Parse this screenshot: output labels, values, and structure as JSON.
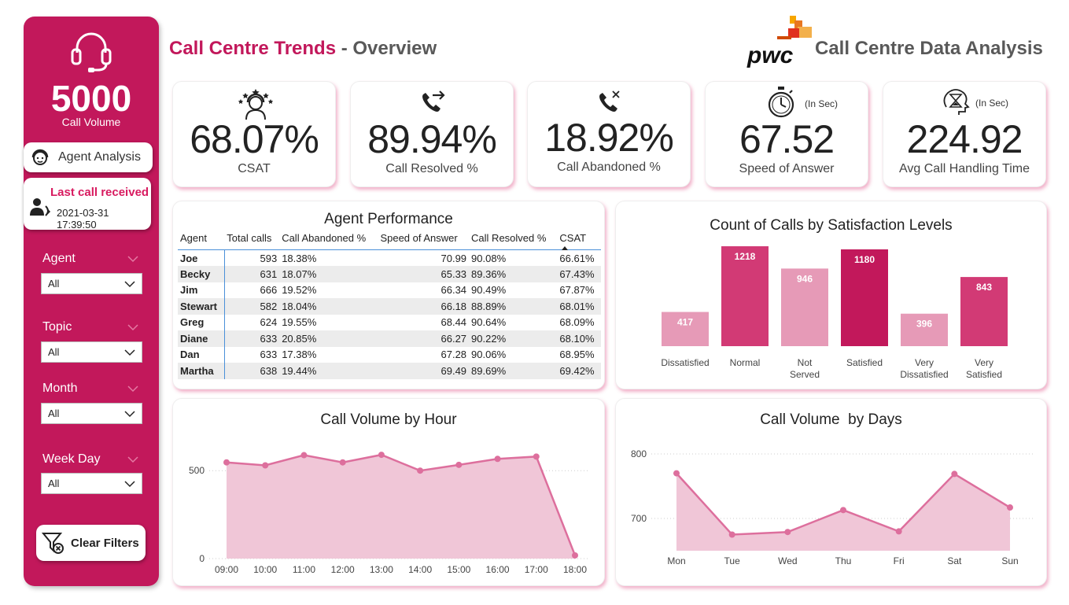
{
  "sidebar": {
    "call_volume": "5000",
    "call_volume_label": "Call Volume",
    "agent_analysis_label": "Agent Analysis",
    "last_call_label": "Last call received",
    "last_call_time": "2021-03-31 17:39:50",
    "filters": [
      {
        "label": "Agent",
        "value": "All"
      },
      {
        "label": "Topic",
        "value": "All"
      },
      {
        "label": "Month",
        "value": "All"
      },
      {
        "label": "Week Day",
        "value": "All"
      }
    ],
    "clear_filters_label": "Clear Filters"
  },
  "header": {
    "title_part1": "Call Centre Trends",
    "title_sep": " - ",
    "title_part2": "Overview",
    "brand_logo_text": "pwc",
    "brand_title": "Call Centre Data Analysis"
  },
  "kpis": [
    {
      "value": "68.07%",
      "label": "CSAT",
      "icon": "agent-rating-icon"
    },
    {
      "value": "89.94%",
      "label": "Call Resolved %",
      "icon": "phone-forward-icon"
    },
    {
      "value": "18.92%",
      "label": "Call Abandoned %",
      "icon": "phone-cancel-icon"
    },
    {
      "value": "67.52",
      "label": "Speed of Answer",
      "unit": "(In Sec)",
      "icon": "stopwatch-icon"
    },
    {
      "value": "224.92",
      "label": "Avg Call Handling Time",
      "unit": "(In Sec)",
      "icon": "hourglass-head-icon"
    }
  ],
  "agent_table": {
    "title": "Agent Performance",
    "columns": [
      "Agent",
      "Total calls",
      "Call Abandoned %",
      "Speed of Answer",
      "Call Resolved %",
      "CSAT"
    ],
    "rows": [
      [
        "Joe",
        "593",
        "18.38%",
        "70.99",
        "90.08%",
        "66.61%"
      ],
      [
        "Becky",
        "631",
        "18.07%",
        "65.33",
        "89.36%",
        "67.43%"
      ],
      [
        "Jim",
        "666",
        "19.52%",
        "66.34",
        "90.49%",
        "67.87%"
      ],
      [
        "Stewart",
        "582",
        "18.04%",
        "66.18",
        "88.89%",
        "68.01%"
      ],
      [
        "Greg",
        "624",
        "19.55%",
        "68.44",
        "90.64%",
        "68.09%"
      ],
      [
        "Diane",
        "633",
        "20.85%",
        "66.27",
        "90.22%",
        "68.10%"
      ],
      [
        "Dan",
        "633",
        "17.38%",
        "67.28",
        "90.06%",
        "68.95%"
      ],
      [
        "Martha",
        "638",
        "19.44%",
        "69.49",
        "89.69%",
        "69.42%"
      ]
    ]
  },
  "colors": {
    "primary": "#c2185b",
    "bar_dark": "#c2185b",
    "bar_mid": "#d23a75",
    "bar_light": "#e69ab7",
    "area_line": "#dd6f9d",
    "area_fill": "#f0c6d7"
  },
  "chart_data": [
    {
      "type": "bar",
      "title": "Count of Calls by Satisfaction Levels",
      "categories": [
        "Dissatisfied",
        "Normal",
        "Not Served",
        "Satisfied",
        "Very Dissatisfied",
        "Very Satisfied"
      ],
      "values": [
        417,
        1218,
        946,
        1180,
        396,
        843
      ],
      "shade": [
        "light",
        "mid",
        "light",
        "dark",
        "light",
        "mid"
      ]
    },
    {
      "type": "area",
      "title": "Call Volume by Hour",
      "categories": [
        "09:00",
        "10:00",
        "11:00",
        "12:00",
        "13:00",
        "14:00",
        "15:00",
        "16:00",
        "17:00",
        "18:00"
      ],
      "values": [
        547,
        530,
        588,
        547,
        590,
        500,
        533,
        567,
        580,
        18
      ],
      "yticks": [
        0,
        500
      ],
      "ylim": [
        0,
        700
      ]
    },
    {
      "type": "area",
      "title": "Call Volume  by Days",
      "categories": [
        "Mon",
        "Tue",
        "Wed",
        "Thu",
        "Fri",
        "Sat",
        "Sun"
      ],
      "values": [
        770,
        675,
        679,
        713,
        680,
        769,
        717
      ],
      "yticks": [
        700,
        800
      ],
      "ylim": [
        650,
        800
      ]
    }
  ]
}
